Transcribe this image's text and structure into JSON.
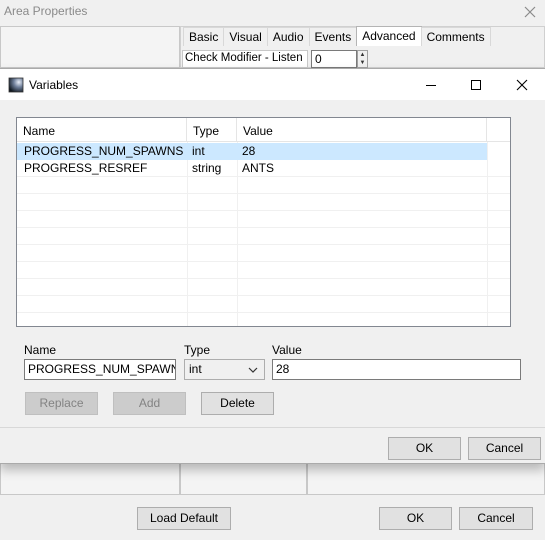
{
  "bg_window": {
    "title": "Area Properties",
    "tabs": [
      "Basic",
      "Visual",
      "Audio",
      "Events",
      "Advanced",
      "Comments"
    ],
    "active_tab": "Advanced",
    "check_modifier_label": "Check Modifier - Listen",
    "check_modifier_value": "0",
    "buttons": {
      "load_default": "Load Default",
      "ok": "OK",
      "cancel": "Cancel"
    }
  },
  "dialog": {
    "title": "Variables",
    "columns": [
      "Name",
      "Type",
      "Value"
    ],
    "rows": [
      {
        "name": "PROGRESS_NUM_SPAWNS",
        "type": "int",
        "value": "28",
        "selected": true
      },
      {
        "name": "PROGRESS_RESREF",
        "type": "string",
        "value": "ANTS",
        "selected": false
      }
    ],
    "form": {
      "name_label": "Name",
      "type_label": "Type",
      "value_label": "Value",
      "name_value": "PROGRESS_NUM_SPAWNS",
      "type_value": "int",
      "value_value": "28"
    },
    "buttons": {
      "replace": "Replace",
      "add": "Add",
      "delete": "Delete",
      "ok": "OK",
      "cancel": "Cancel"
    }
  },
  "icons": {
    "bg_close": "close-icon",
    "dialog_app": "app-icon",
    "minimize": "minimize-icon",
    "maximize": "maximize-icon",
    "close": "close-icon",
    "select_arrow": "chevron-down-icon"
  },
  "colors": {
    "selection": "#cce8ff",
    "window_bg": "#f0f0f0",
    "title_bar": "#ffffff"
  }
}
